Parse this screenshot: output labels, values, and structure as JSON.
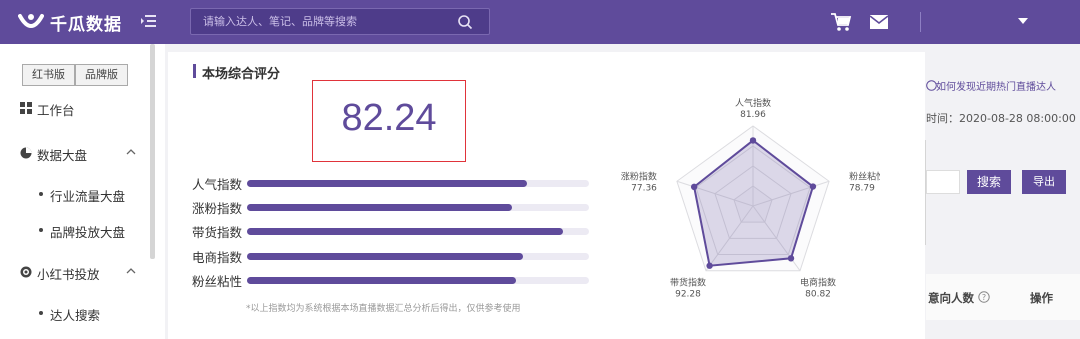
{
  "header": {
    "brand": "千瓜数据",
    "search_placeholder": "请输入达人、笔记、品牌等搜索"
  },
  "sidebar": {
    "tabs": [
      "红书版",
      "品牌版"
    ],
    "workbench": "工作台",
    "data_board": "数据大盘",
    "data_board_children": [
      "行业流量大盘",
      "品牌投放大盘"
    ],
    "xhs_ads": "小红书投放",
    "xhs_ads_children": [
      "达人搜索"
    ]
  },
  "background": {
    "help_link": "如何发现近期热门直播达人",
    "time_text": "时间：2020-08-28 08:00:00",
    "search_button": "搜索",
    "export_button": "导出",
    "col_intent": "意向人数",
    "col_action": "操作"
  },
  "modal": {
    "section_title": "本场综合评分",
    "overall_score": "82.24",
    "footnote": "*以上指数均为系统根据本场直播数据汇总分析后得出，仅供参考使用",
    "metrics": [
      {
        "label": "人气指数",
        "value": 81.96
      },
      {
        "label": "涨粉指数",
        "value": 77.36
      },
      {
        "label": "带货指数",
        "value": 92.28
      },
      {
        "label": "电商指数",
        "value": 80.82
      },
      {
        "label": "粉丝粘性",
        "value": 78.79
      }
    ]
  },
  "chart_data": {
    "type": "radar",
    "axes": [
      "人气指数",
      "粉丝粘性",
      "电商指数",
      "带货指数",
      "涨粉指数"
    ],
    "values": [
      81.96,
      78.79,
      80.82,
      92.28,
      77.36
    ],
    "value_labels": [
      "81.96",
      "78.79",
      "80.82",
      "92.28",
      "77.36"
    ],
    "range": [
      0,
      100
    ],
    "colors": {
      "fill": "#5f4b9b",
      "grid": "#dcdce0"
    }
  }
}
